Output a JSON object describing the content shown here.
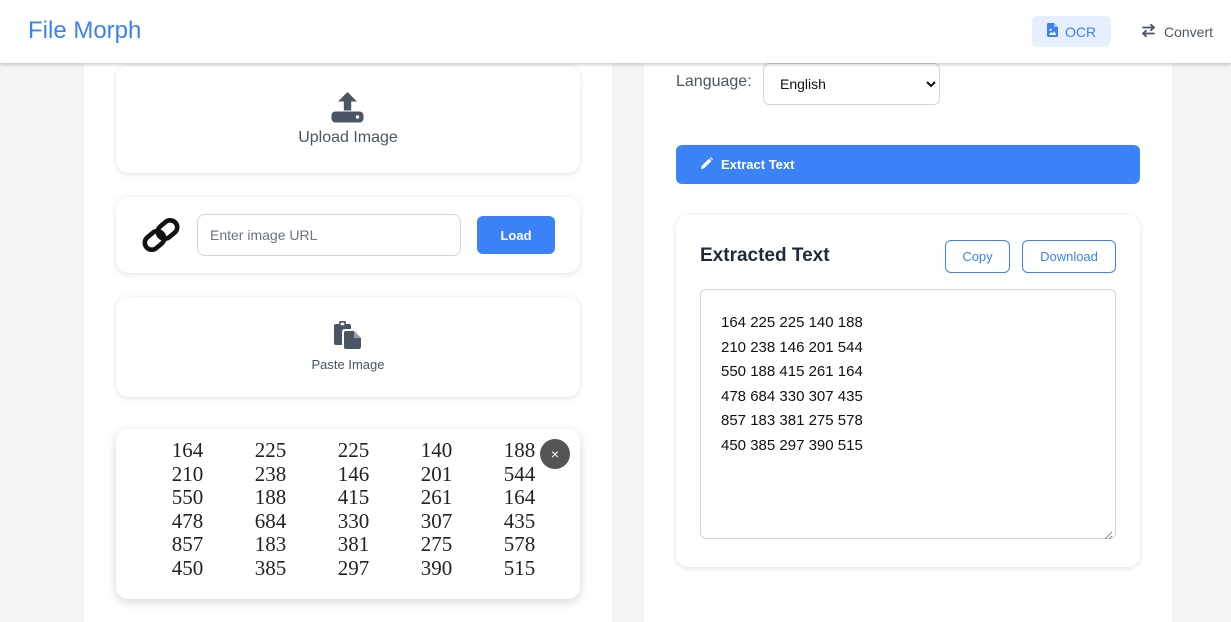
{
  "header": {
    "brand": "File Morph",
    "nav": [
      {
        "label": "OCR",
        "icon": "file-image-icon",
        "active": true
      },
      {
        "label": "Convert",
        "icon": "swap-arrows-icon",
        "active": false
      }
    ]
  },
  "upload": {
    "label": "Upload Image",
    "icon": "upload-icon"
  },
  "url_loader": {
    "placeholder": "Enter image URL",
    "value": "",
    "button_label": "Load",
    "icon": "link-icon"
  },
  "paste": {
    "label": "Paste Image",
    "icon": "paste-icon"
  },
  "preview": {
    "close_label": "×",
    "rows": [
      [
        "164",
        "225",
        "225",
        "140",
        "188"
      ],
      [
        "210",
        "238",
        "146",
        "201",
        "544"
      ],
      [
        "550",
        "188",
        "415",
        "261",
        "164"
      ],
      [
        "478",
        "684",
        "330",
        "307",
        "435"
      ],
      [
        "857",
        "183",
        "381",
        "275",
        "578"
      ],
      [
        "450",
        "385",
        "297",
        "390",
        "515"
      ]
    ]
  },
  "language": {
    "label": "Language:",
    "selected": "English"
  },
  "extract": {
    "label": "Extract Text",
    "icon": "pencil-icon"
  },
  "result": {
    "title": "Extracted Text",
    "copy_label": "Copy",
    "download_label": "Download",
    "lines": [
      "164 225 225 140 188",
      "210 238 146 201 544",
      "550 188 415 261 164",
      "478 684 330 307 435",
      "857 183 381 275 578",
      "450 385 297 390 515"
    ]
  },
  "colors": {
    "accent": "#3b82f6",
    "accent_light": "#e6effd",
    "icon_dark": "#4b5563"
  }
}
